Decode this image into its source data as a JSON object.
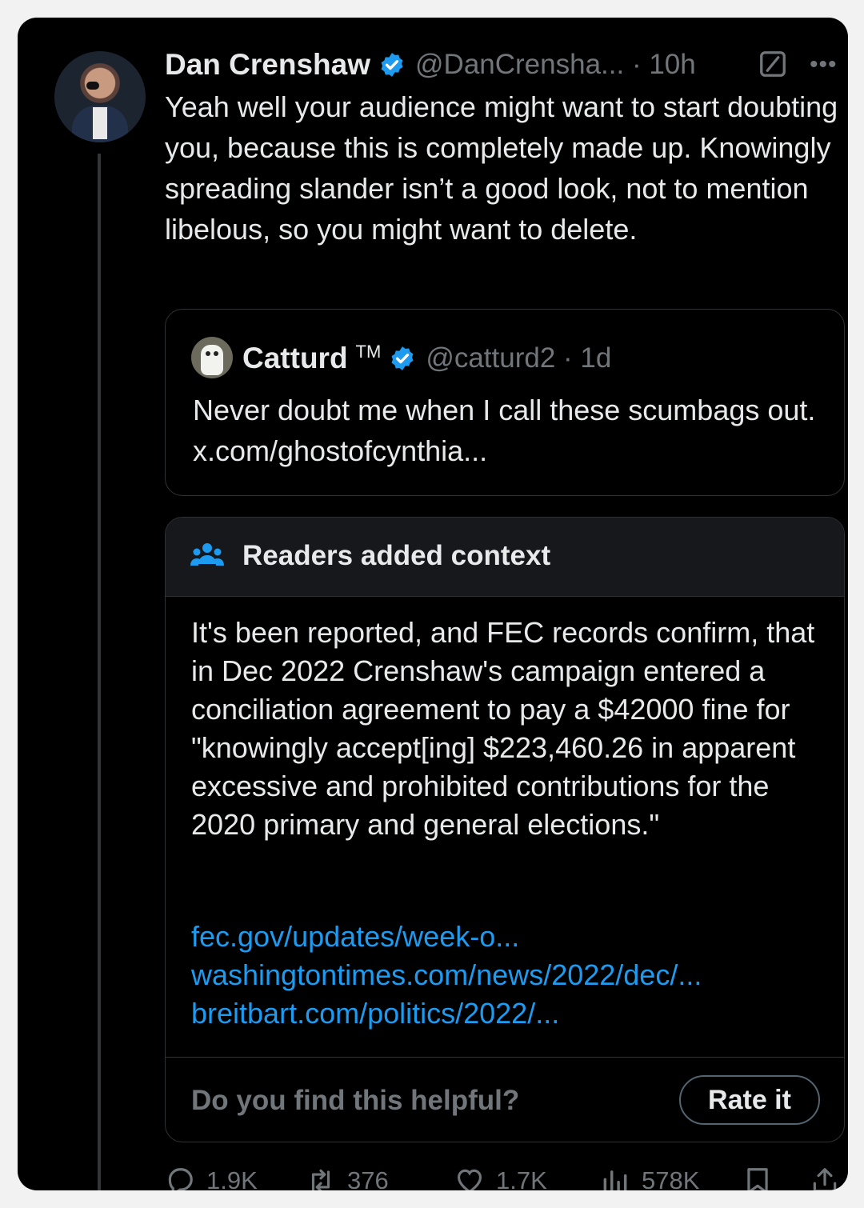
{
  "post": {
    "author_name": "Dan Crenshaw",
    "handle_time": "@DanCrensha... · 10h",
    "text": "Yeah well your audience might want to start doubting you, because this is completely made up. Knowingly spreading slander isn’t a good look, not to mention libelous, so you might want to delete."
  },
  "quote": {
    "author_name": "Catturd",
    "tm": "TM",
    "handle_time": "@catturd2 · 1d",
    "text": "Never doubt me when I call these scumbags out. x.com/ghostofcynthia..."
  },
  "note": {
    "title": "Readers added context",
    "body": "It's been reported, and FEC records confirm, that in Dec 2022 Crenshaw's campaign entered a conciliation agreement to pay a $42000 fine for \"knowingly accept[ing] $223,460.26 in apparent excessive and prohibited contributions for the 2020 primary and general elections.\"",
    "links": [
      "fec.gov/updates/week-o...",
      "washingtontimes.com/news/2022/dec/...",
      "breitbart.com/politics/2022/..."
    ],
    "question": "Do you find this helpful?",
    "rate_label": "Rate it"
  },
  "actions": {
    "replies": "1.9K",
    "reposts": "376",
    "likes": "1.7K",
    "views": "578K"
  },
  "colors": {
    "background": "#000000",
    "text": "#e7e9ea",
    "muted": "#71767b",
    "link": "#1d9bf0",
    "verified": "#1d9bf0",
    "border": "#2f3336"
  },
  "icons": [
    "verified-badge-icon",
    "grok-icon",
    "more-icon",
    "readers-icon",
    "reply-icon",
    "repost-icon",
    "like-icon",
    "views-icon",
    "bookmark-icon",
    "share-icon"
  ]
}
